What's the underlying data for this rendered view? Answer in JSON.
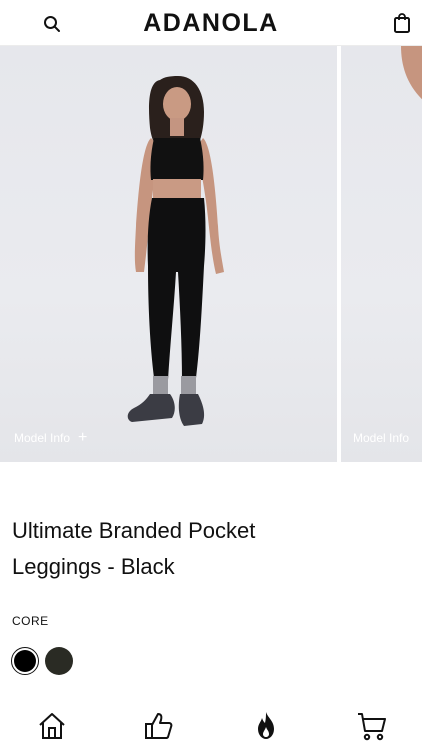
{
  "header": {
    "brand": "ADANOLA",
    "search_icon": "search-icon",
    "bag_icon": "shopping-bag-icon"
  },
  "gallery": {
    "slides": [
      {
        "model_info_label": "Model Info"
      },
      {
        "model_info_label": "Model Info"
      }
    ]
  },
  "product": {
    "title": "Ultimate Branded Pocket Leggings - Black",
    "collection": "CORE",
    "colors": [
      {
        "hex": "#000000",
        "selected": true
      },
      {
        "hex": "#2a2b24",
        "selected": false
      }
    ]
  },
  "bottom_nav": {
    "items": [
      "home-icon",
      "thumbs-up-icon",
      "flame-icon",
      "cart-icon"
    ]
  }
}
